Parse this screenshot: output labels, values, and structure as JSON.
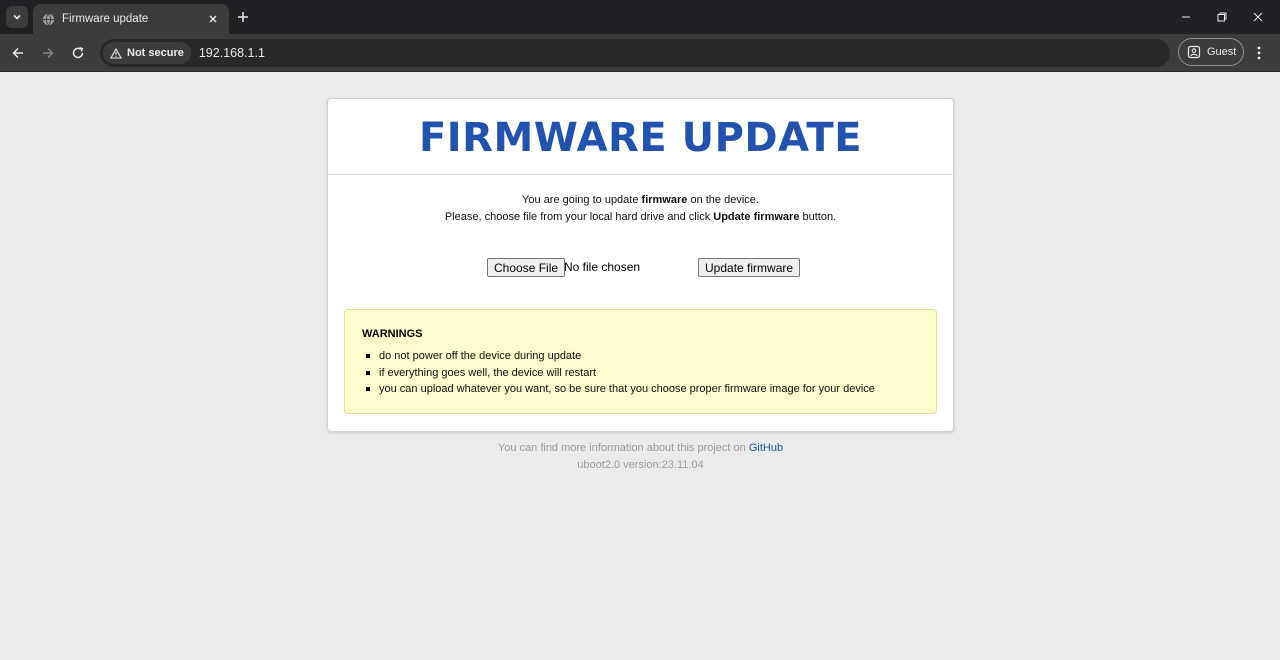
{
  "browser": {
    "tab_title": "Firmware update",
    "security_label": "Not secure",
    "url": "192.168.1.1",
    "profile_label": "Guest"
  },
  "page": {
    "title": "FIRMWARE UPDATE",
    "intro_line1_prefix": "You are going to update ",
    "intro_line1_bold": "firmware",
    "intro_line1_suffix": " on the device.",
    "intro_line2_prefix": "Please, choose file from your local hard drive and click ",
    "intro_line2_bold": "Update firmware",
    "intro_line2_suffix": " button.",
    "choose_file_label": "Choose File",
    "file_status": "No file chosen",
    "update_button_label": "Update firmware"
  },
  "warnings": {
    "title": "WARNINGS",
    "items": [
      "do not power off the device during update",
      "if everything goes well, the device will restart",
      "you can upload whatever you want, so be sure that you choose proper firmware image for your device"
    ]
  },
  "footer": {
    "info_prefix": "You can find more information about this project on ",
    "link_label": "GitHub",
    "version": "uboot2.0 version:23.11.04"
  },
  "colors": {
    "title_blue": "#2352ae",
    "warning_bg": "#fdfccc",
    "page_bg": "#ebebeb"
  }
}
